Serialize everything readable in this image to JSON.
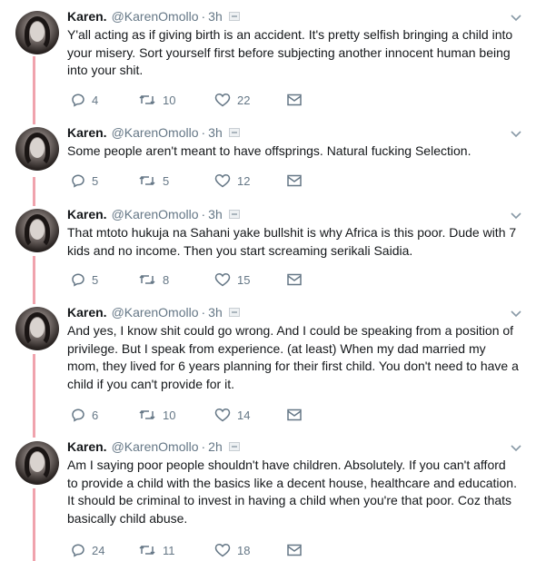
{
  "colors": {
    "thread_line": "#f0a3ad",
    "muted": "#657786",
    "text": "#14171a"
  },
  "tweets": [
    {
      "name": "Karen.",
      "handle": "@KarenOmollo",
      "time": "3h",
      "lines": [
        "Y'all acting as if giving birth is an accident.  It's pretty selfish bringing a child into",
        "your misery. Sort yourself first before subjecting another innocent human being",
        "into your shit."
      ],
      "replies": "4",
      "retweets": "10",
      "likes": "22"
    },
    {
      "name": "Karen.",
      "handle": "@KarenOmollo",
      "time": "3h",
      "lines": [
        "Some people aren't meant to have offsprings. Natural fucking Selection."
      ],
      "replies": "5",
      "retweets": "5",
      "likes": "12"
    },
    {
      "name": "Karen.",
      "handle": "@KarenOmollo",
      "time": "3h",
      "lines": [
        "That mtoto hukuja na Sahani yake bullshit is why Africa is this poor. Dude with 7",
        "kids and no income. Then you start screaming serikali Saidia."
      ],
      "replies": "5",
      "retweets": "8",
      "likes": "15"
    },
    {
      "name": "Karen.",
      "handle": "@KarenOmollo",
      "time": "3h",
      "lines": [
        "And yes, I know shit could go wrong. And I could be speaking from a position of",
        "privilege. But I speak from experience. (at least)   When my dad married my",
        "mom, they lived for 6 years planning for their first child. You don't need to have a",
        "child if you can't provide for it."
      ],
      "replies": "6",
      "retweets": "10",
      "likes": "14"
    },
    {
      "name": "Karen.",
      "handle": "@KarenOmollo",
      "time": "2h",
      "lines": [
        "Am I saying poor people shouldn't have children. Absolutely.  If you can't afford",
        "to provide a child with the basics like a decent house, healthcare and education.",
        "It should be criminal to invest in  having a child when you're that poor. Coz thats",
        "basically child abuse."
      ],
      "replies": "24",
      "retweets": "11",
      "likes": "18"
    }
  ]
}
